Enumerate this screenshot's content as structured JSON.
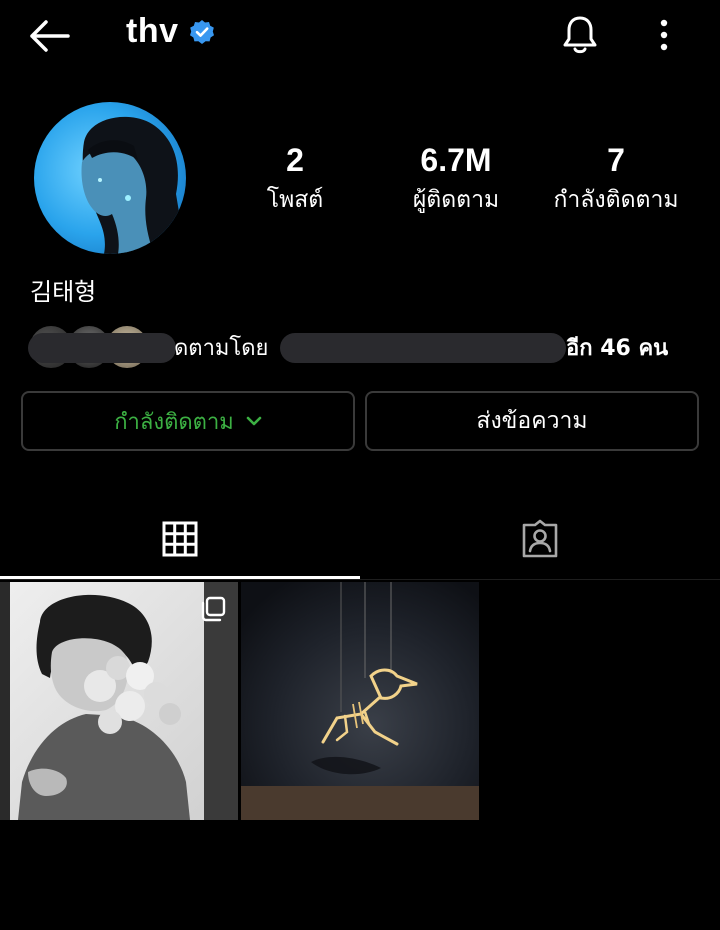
{
  "header": {
    "username": "thv",
    "back_icon": "arrow-left-icon",
    "verified_icon": "verified-badge-icon",
    "notification_icon": "bell-icon",
    "more_icon": "more-vertical-icon",
    "verified_color": "#3897f0"
  },
  "profile": {
    "display_name": "김태형",
    "stats": {
      "posts": {
        "value": "2",
        "label": "โพสต์"
      },
      "followers": {
        "value": "6.7M",
        "label": "ผู้ติดตาม"
      },
      "following": {
        "value": "7",
        "label": "กำลังติดตาม"
      }
    },
    "followed_by": {
      "text": "ดตามโดย",
      "more": "อีก 46 คน"
    }
  },
  "actions": {
    "following_label": "กำลังติดตาม",
    "following_color": "#3cb043",
    "message_label": "ส่งข้อความ"
  },
  "tabs": [
    {
      "icon": "grid-icon",
      "active": true
    },
    {
      "icon": "tagged-person-icon",
      "active": false
    }
  ],
  "posts": [
    {
      "type": "carousel",
      "icon": "multiple-posts-icon"
    },
    {
      "type": "single"
    }
  ]
}
